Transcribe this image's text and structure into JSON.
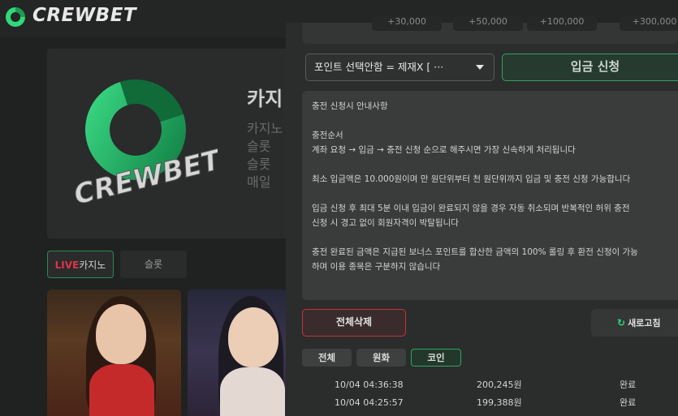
{
  "brand": {
    "name": "CREWBET",
    "accent": "#2fa565"
  },
  "banner": {
    "logo_text": "CREWBET",
    "title": "카지",
    "lines": [
      "카지노",
      "슬롯 ",
      "슬롯 ",
      "매일 "
    ]
  },
  "categories": {
    "live_tag": "LIVE",
    "live_label": "카지노",
    "slot_label": "슬롯"
  },
  "deposit_modal": {
    "quick_amounts": [
      "+30,000",
      "+50,000",
      "+100,000",
      "+300,000"
    ],
    "point_select": {
      "value": "포인트 선택안함 = 제재X [ ···"
    },
    "deposit_button": "입금 신청",
    "notice": {
      "title": "충전 신청시 안내사항",
      "section_heading": "충전순서",
      "order_line": "계좌 요청 → 입금 → 충전 신청 순으로 해주시면 가장 신속하게 처리됩니다",
      "min_line": "최소 입금액은 10.000원이며 만 원단위부터 천 원단위까지 입금 및 충전 신청 가능합니다",
      "warn_line1": "입금 신청 후 최대 5분 이내 입금이 완료되지 않을 경우 자동 취소되며 반복적인 허위 충전",
      "warn_line2": "신청 시 경고 없이 회원자격이 박탈됩니다",
      "rolling_line1": "충전 완료된 금액은 지급된 보너스 포인트를 합산한 금액의 100% 롤링 후 환전 신청이 가능",
      "rolling_line2": "하며 이용 종목은 구분하지 않습니다"
    },
    "delete_all_button": "전체삭제",
    "refresh_button": "새로고침",
    "filters": [
      "전체",
      "원화",
      "코인"
    ],
    "active_filter": "코인",
    "history": [
      {
        "date": "10/04 04:36:38",
        "amount": "200,245원",
        "status": "완료"
      },
      {
        "date": "10/04 04:25:57",
        "amount": "199,388원",
        "status": "완료"
      }
    ]
  }
}
